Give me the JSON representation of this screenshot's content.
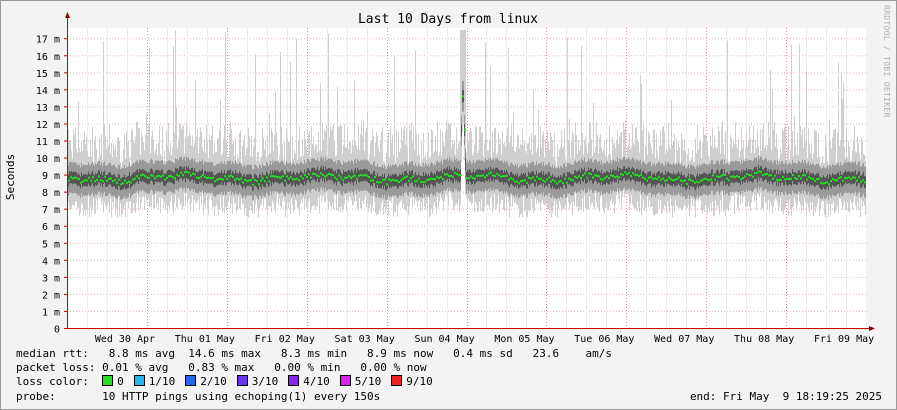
{
  "chart_data": {
    "type": "area",
    "title": "Last 10 Days from linux",
    "ylabel": "Seconds",
    "watermark": "RRDTOOL / TOBI OETIKER",
    "ylim": [
      0,
      17.6
    ],
    "y_ticks": [
      "0",
      "1 m",
      "2 m",
      "3 m",
      "4 m",
      "5 m",
      "6 m",
      "7 m",
      "8 m",
      "9 m",
      "10 m",
      "11 m",
      "12 m",
      "13 m",
      "14 m",
      "15 m",
      "16 m",
      "17 m"
    ],
    "y_tick_values": [
      0,
      1,
      2,
      3,
      4,
      5,
      6,
      7,
      8,
      9,
      10,
      11,
      12,
      13,
      14,
      15,
      16,
      17
    ],
    "y_unit_note": "m = milliseconds",
    "x_ticks": [
      "Wed 30 Apr",
      "Thu 01 May",
      "Fri 02 May",
      "Sat 03 May",
      "Sun 04 May",
      "Mon 05 May",
      "Tue 06 May",
      "Wed 07 May",
      "Thu 08 May",
      "Fri 09 May"
    ],
    "x_range_days": 10,
    "series": [
      {
        "name": "median rtt",
        "color": "#22dd22",
        "median_ms": 8.8,
        "spike_day_offset": 4.95,
        "spike_peak_ms": 14.6
      },
      {
        "name": "smoke",
        "color": "#555555",
        "min_ms": 6.5,
        "max_ms": 17.5
      }
    ]
  },
  "legend": {
    "median_rtt_label": "median rtt:",
    "median_rtt_values": "8.8 ms avg  14.6 ms max   8.3 ms min   8.9 ms now   0.4 ms sd   23.6    am/s",
    "packet_loss_label": "packet loss:",
    "packet_loss_values": "0.01 % avg   0.83 % max   0.00 % min   0.00 % now",
    "loss_color_label": "loss color:",
    "loss_colors": [
      {
        "label": "0",
        "color": "#22dd22"
      },
      {
        "label": "1/10",
        "color": "#22bbee"
      },
      {
        "label": "2/10",
        "color": "#2266ee"
      },
      {
        "label": "3/10",
        "color": "#6633ee"
      },
      {
        "label": "4/10",
        "color": "#8822ee"
      },
      {
        "label": "5/10",
        "color": "#dd22ee"
      },
      {
        "label": "9/10",
        "color": "#ee2222"
      }
    ],
    "probe_label": "probe:",
    "probe_value": "10 HTTP pings using echoping(1) every 150s",
    "end_label": "end: Fri May  9 18:19:25 2025"
  }
}
